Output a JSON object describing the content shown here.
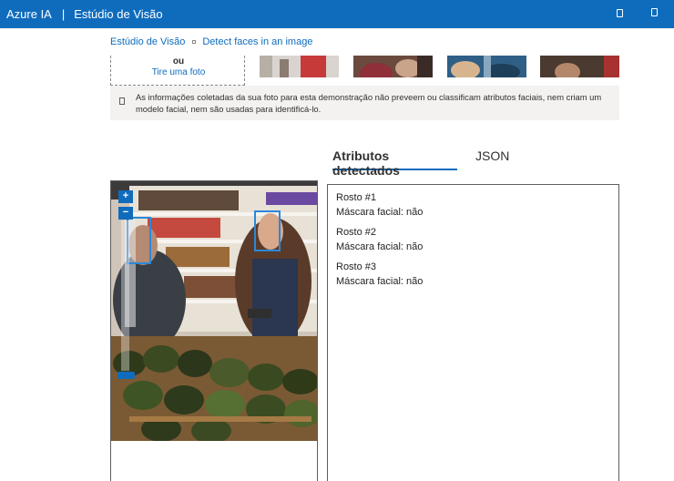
{
  "header": {
    "brand": "Azure IA",
    "separator": "|",
    "title": "Estúdio de Visão"
  },
  "breadcrumb": {
    "items": [
      "Estúdio de Visão",
      "Detect faces in an image"
    ]
  },
  "upload": {
    "or_label": "ou",
    "take_photo": "Tire uma foto"
  },
  "info": {
    "text": "As informações coletadas da sua foto para esta demonstração não preveem ou classificam atributos faciais, nem criam um modelo facial, nem são usadas para identificá-lo."
  },
  "zoom": {
    "in_label": "+",
    "out_label": "−"
  },
  "tabs": [
    {
      "label": "Atributos detectados",
      "active": true
    },
    {
      "label": "JSON",
      "active": false
    }
  ],
  "results": [
    {
      "title": "Rosto #1",
      "attribute": "Máscara facial: não"
    },
    {
      "title": "Rosto #2",
      "attribute": "Máscara facial: não"
    },
    {
      "title": "Rosto #3",
      "attribute": "Máscara facial: não"
    }
  ],
  "colors": {
    "accent": "#0f6cbd",
    "face_box": "#2b88d8",
    "info_bg": "#f3f2f1"
  }
}
